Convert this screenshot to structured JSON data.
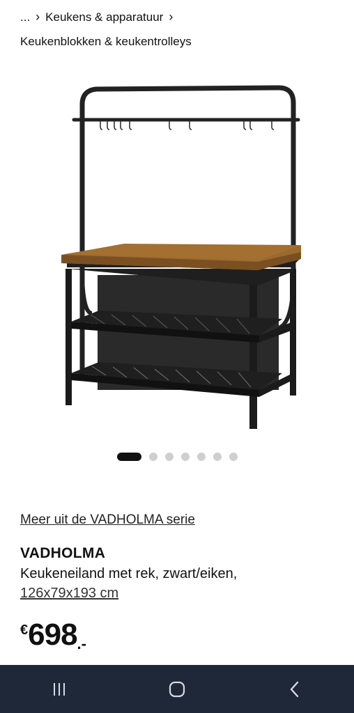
{
  "breadcrumb": {
    "ellipsis": "...",
    "items": [
      "Keukens & apparatuur"
    ],
    "current": "Keukenblokken & keukentrolleys"
  },
  "gallery": {
    "total": 7,
    "active_index": 0
  },
  "series_link": "Meer uit de VADHOLMA serie",
  "product": {
    "name": "VADHOLMA",
    "description": "Keukeneiland met rek, zwart/eiken,",
    "dimensions": "126x79x193 cm"
  },
  "price": {
    "currency": "€",
    "integer": "698",
    "decimal": ".-"
  },
  "nav": {
    "recents": "recents-icon",
    "home": "home-icon",
    "back": "back-icon"
  },
  "colors": {
    "nav_bg": "#1e2838",
    "dot_active": "#111111",
    "dot_inactive": "#cfcfcf"
  }
}
